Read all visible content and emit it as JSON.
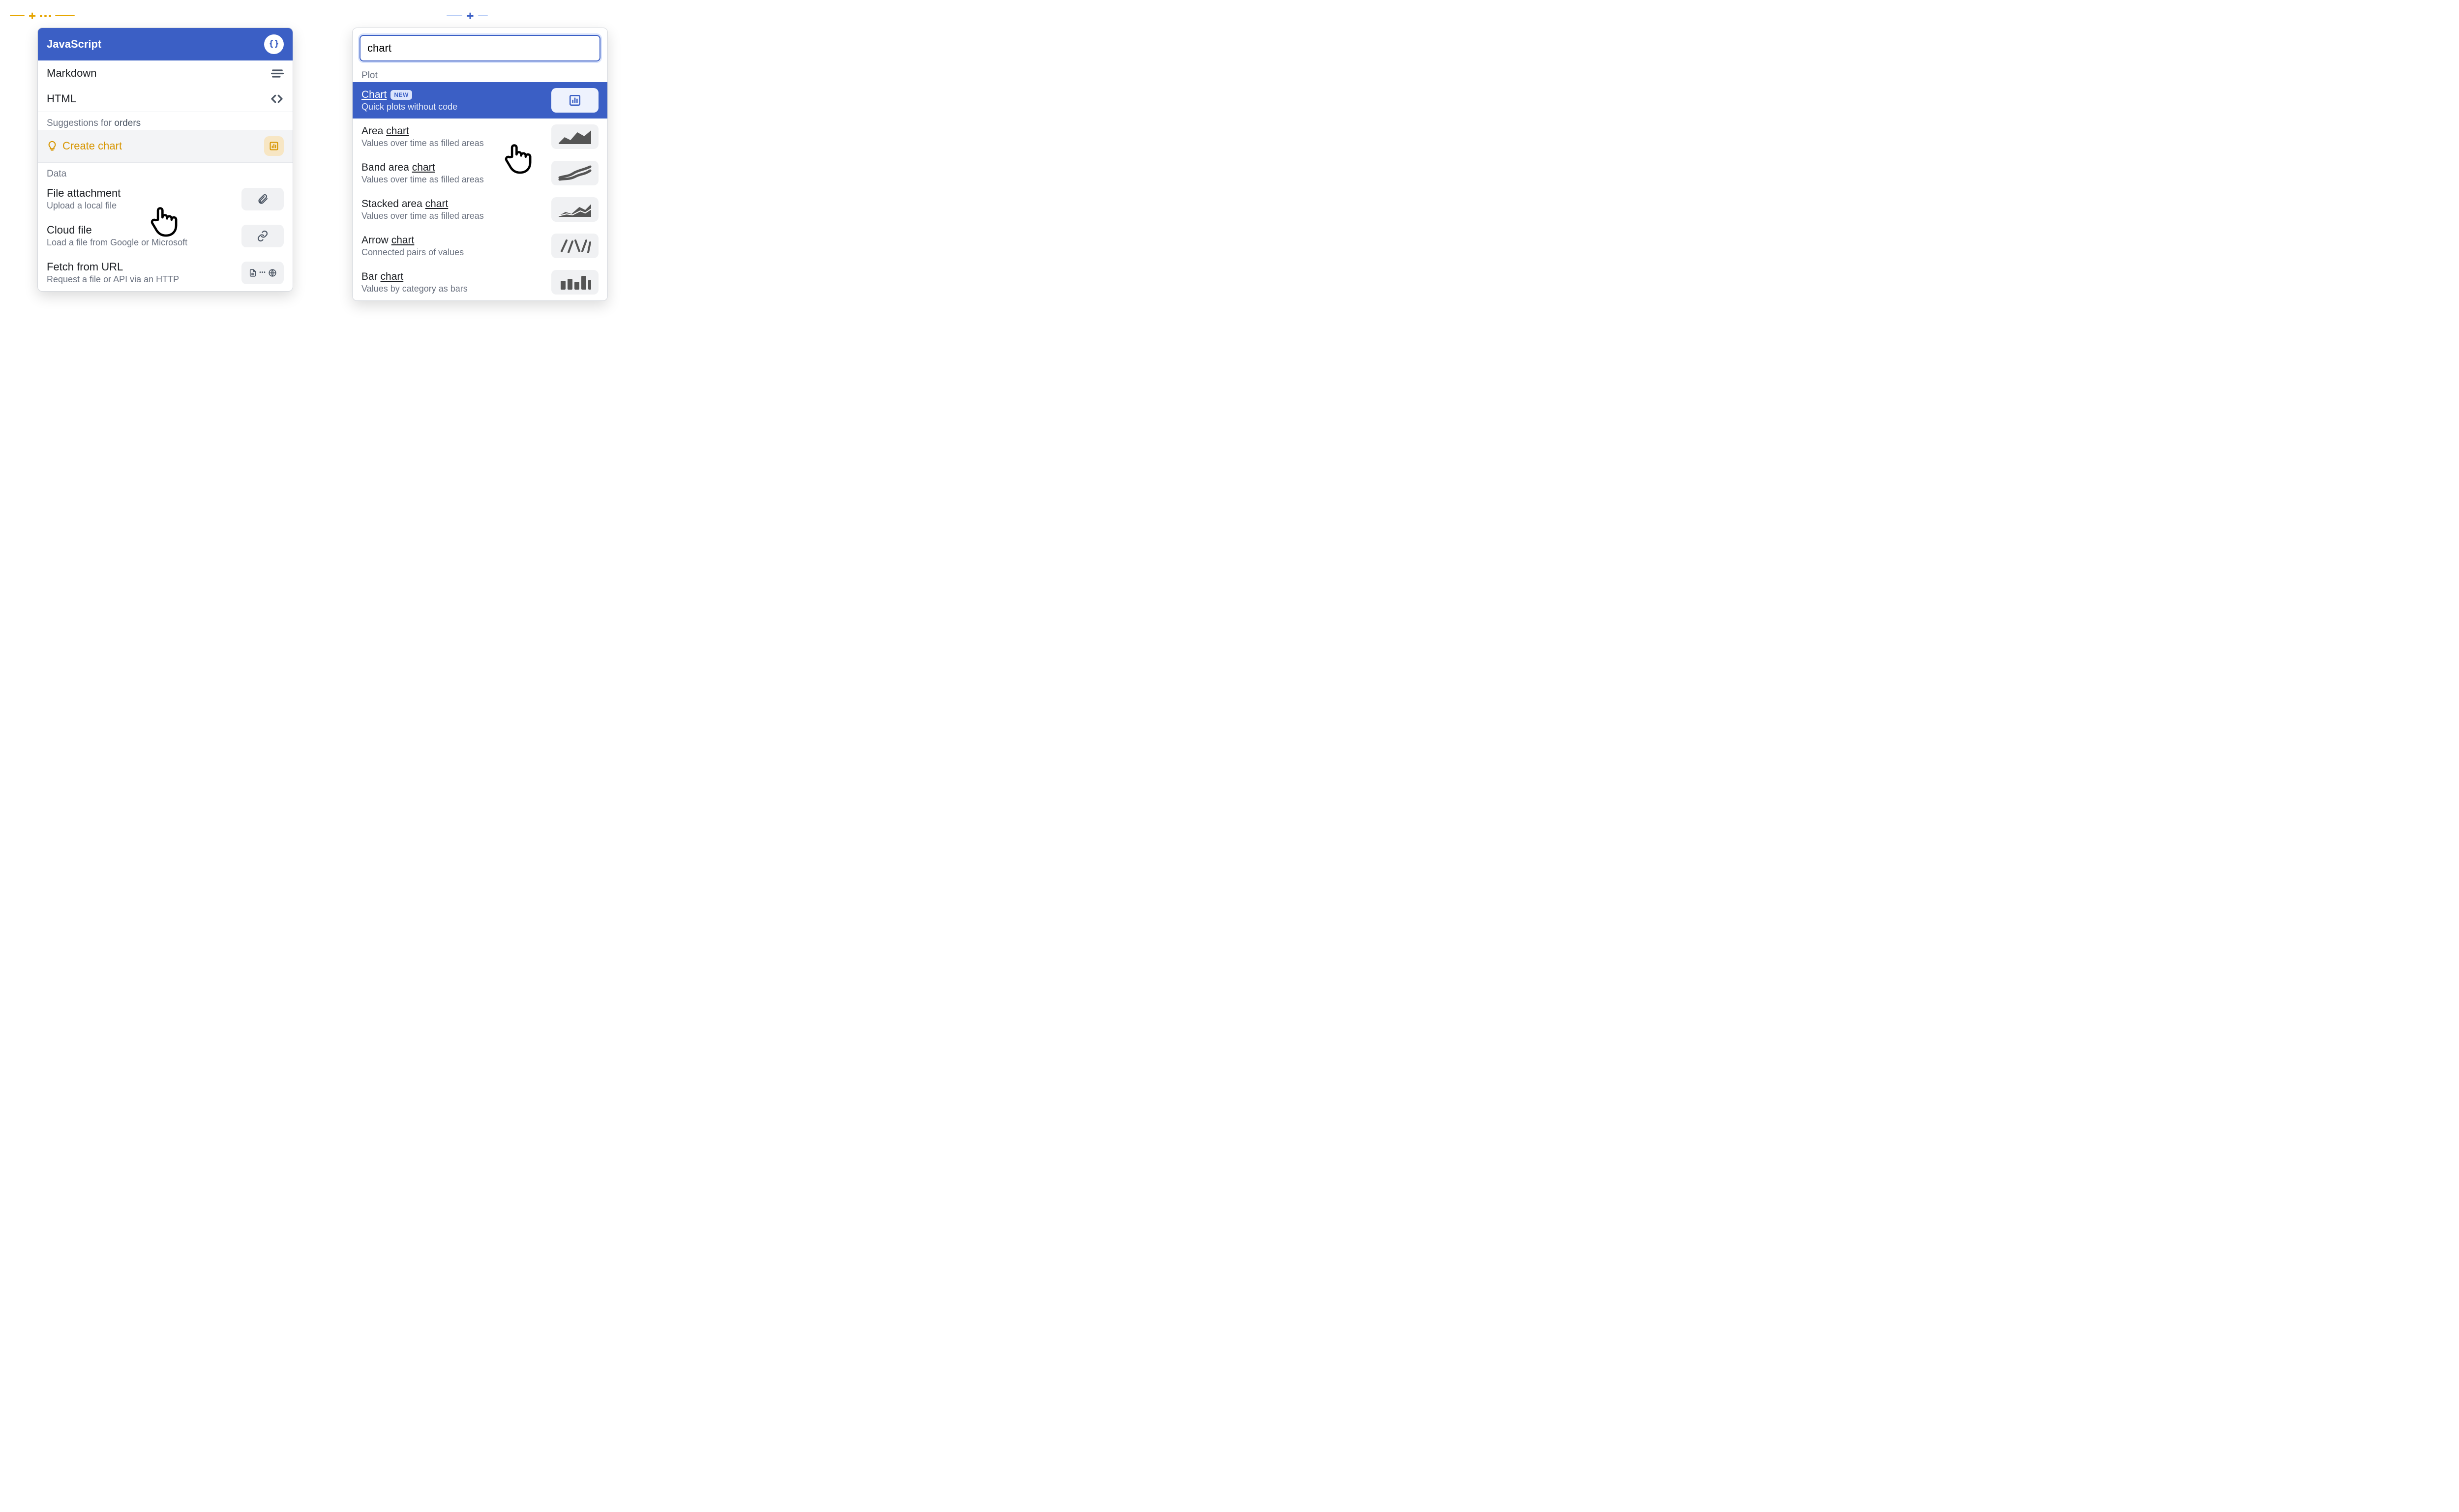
{
  "left": {
    "addbar": {
      "plus": "+",
      "dots": 3
    },
    "primary": {
      "label": "JavaScript"
    },
    "rows": [
      {
        "label": "Markdown"
      },
      {
        "label": "HTML"
      }
    ],
    "suggest": {
      "prefix": "Suggestions for",
      "target": "orders",
      "item": "Create chart"
    },
    "data_section": {
      "label": "Data",
      "items": [
        {
          "title": "File attachment",
          "desc": "Upload a local file"
        },
        {
          "title": "Cloud file",
          "desc": "Load a file from Google or Microsoft"
        },
        {
          "title": "Fetch from URL",
          "desc": "Request a file or API via an HTTP"
        }
      ]
    }
  },
  "right": {
    "addbar": {
      "plus": "+"
    },
    "search_value": "chart",
    "section_label": "Plot",
    "results": [
      {
        "pre": "",
        "match": "Chart",
        "post": "",
        "badge": "NEW",
        "desc": "Quick plots without code",
        "selected": true,
        "icon": "bar-chart-icon"
      },
      {
        "pre": "Area ",
        "match": "chart",
        "post": "",
        "desc": "Values over time as filled areas",
        "icon": "area-icon"
      },
      {
        "pre": "Band area ",
        "match": "chart",
        "post": "",
        "desc": "Values over time as filled areas",
        "icon": "band-icon"
      },
      {
        "pre": "Stacked area ",
        "match": "chart",
        "post": "",
        "desc": "Values over time as filled areas",
        "icon": "stacked-area-icon"
      },
      {
        "pre": "Arrow ",
        "match": "chart",
        "post": "",
        "desc": "Connected pairs of values",
        "icon": "arrow-chart-icon"
      },
      {
        "pre": "Bar ",
        "match": "chart",
        "post": "",
        "desc": "Values by category as bars",
        "icon": "bars-icon"
      }
    ]
  }
}
